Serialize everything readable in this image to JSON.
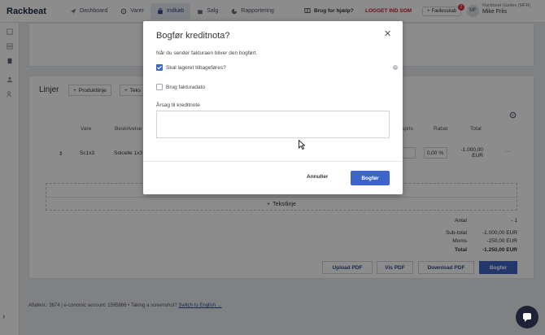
{
  "topbar": {
    "logo": "Rackbeat",
    "nav": [
      {
        "label": "Dashboard",
        "icon": "paper-plane-icon"
      },
      {
        "label": "Varer",
        "icon": "gear-icon"
      },
      {
        "label": "Indkøb",
        "icon": "bag-icon",
        "active": true
      },
      {
        "label": "Salg",
        "icon": "shopping-bag-icon"
      },
      {
        "label": "Rapportering",
        "icon": "pie-chart-icon"
      }
    ],
    "help": "Brug for hjælp?",
    "logged_in_as": "LOGGET IND SOM",
    "shared": "Fællesskab",
    "notification_count": "2",
    "avatar_initials": "MF",
    "org": "Rackbeat Guides (MFR)",
    "user_name": "Mike Friis"
  },
  "lines": {
    "title": "Linjer",
    "product_line_btn": "Produktlinje",
    "text_btn": "Teks",
    "headers": {
      "vare": "Vare",
      "beskrivelse": "Beskrivelse",
      "pris": "spris",
      "rabat": "Rabat",
      "total": "Total"
    },
    "row": {
      "vare": "Sc1x3",
      "beskrivelse": "Solcelle 1x3",
      "rabat": "0,00 %",
      "total_amount": "-1.000,00",
      "total_currency": "EUR"
    },
    "text_line": "Tekstlinje"
  },
  "summary": {
    "antal_label": "Antal",
    "antal_value": "- 1",
    "subtotal_label": "Sub-total",
    "subtotal_value": "-1.000,00 EUR",
    "moms_label": "Moms",
    "moms_value": "-250,00 EUR",
    "total_label": "Total",
    "total_value": "-1.250,00 EUR"
  },
  "buttons": {
    "upload_pdf": "Upload PDF",
    "view_pdf": "Vis PDF",
    "download_pdf": "Download PDF",
    "book": "Bogfør"
  },
  "footer": {
    "text": "Aftalenr.: 3674 | e-conomic account: 1595866   •   Taking a screenshot?",
    "link": "Switch to English →"
  },
  "modal": {
    "title": "Bogfør kreditnota?",
    "subtitle": "Når du sender fakturaen bliver den bogført.",
    "checkbox_restock": "Skal lageret tilbageføres?",
    "checkbox_restock_checked": true,
    "checkbox_invoice_date": "Brug fakturadato",
    "checkbox_invoice_date_checked": false,
    "reason_label": "Årsag til kreditnote",
    "reason_value": "",
    "cancel": "Annuller",
    "confirm": "Bogfør",
    "help_mark": "?"
  },
  "colors": {
    "primary": "#3d64c9",
    "logged_in_red": "#d11d2f",
    "overlay": "rgba(0,0,0,0.45)"
  }
}
